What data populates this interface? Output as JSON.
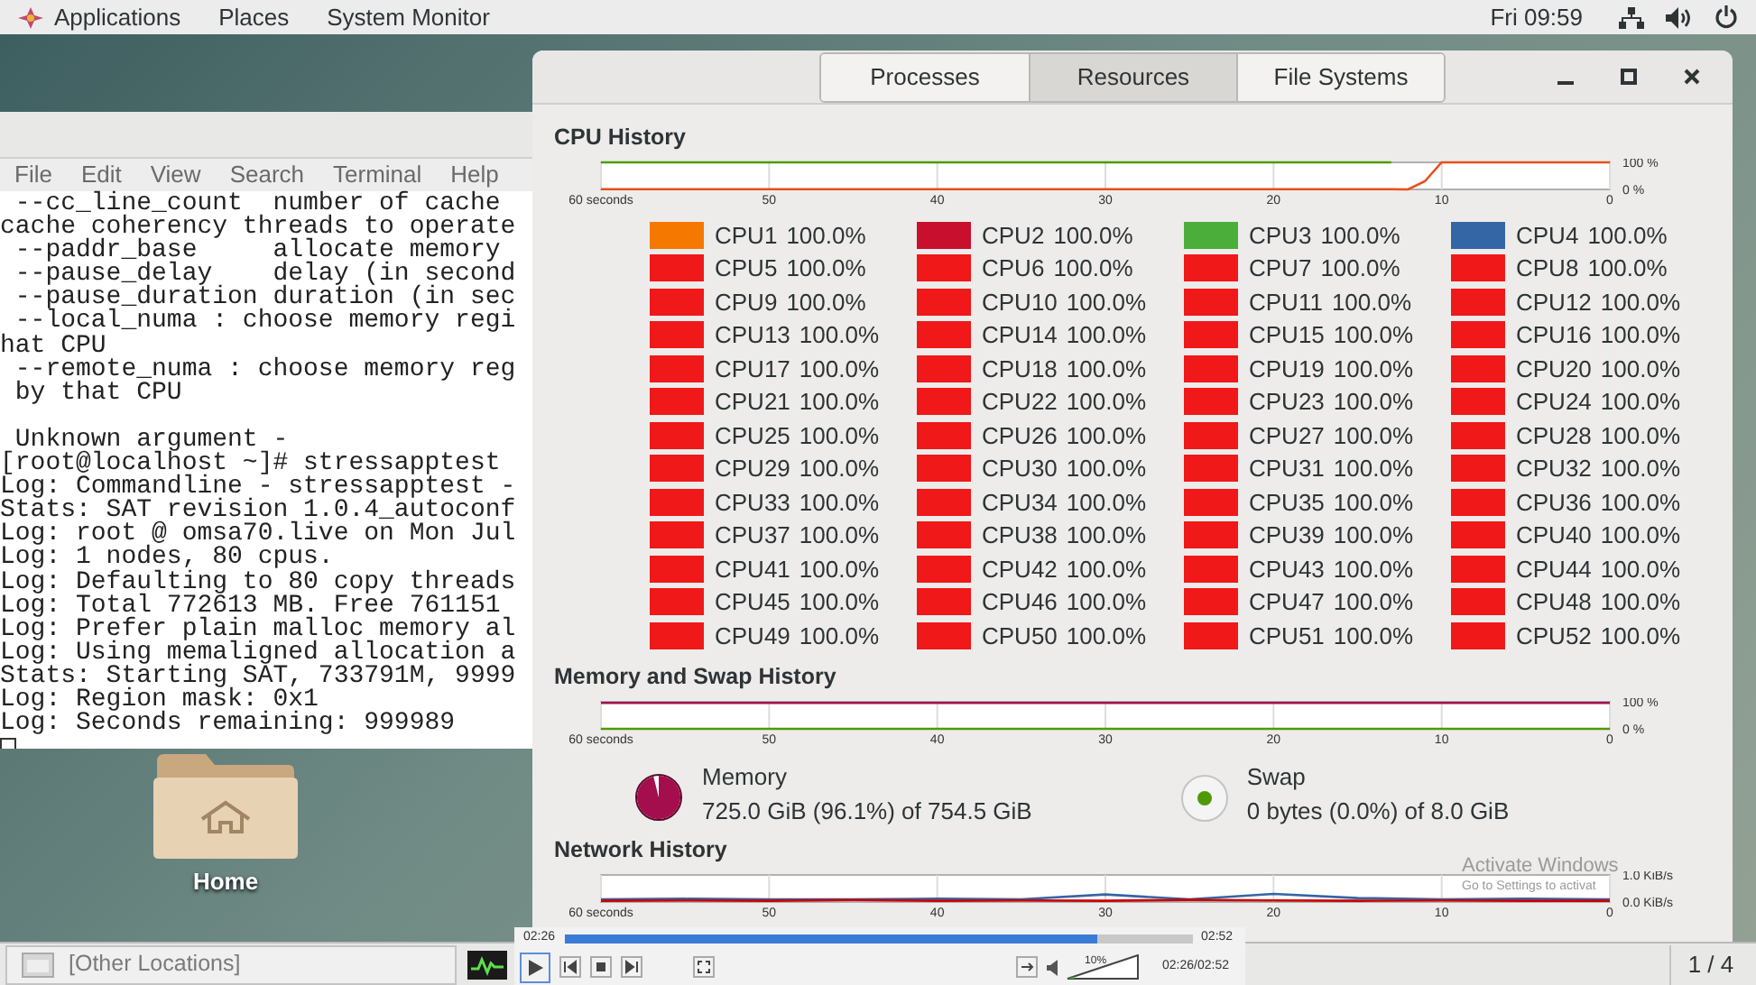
{
  "top_bar": {
    "menus": [
      "Applications",
      "Places",
      "System Monitor"
    ],
    "clock": "Fri 09:59"
  },
  "terminal": {
    "menu": [
      "File",
      "Edit",
      "View",
      "Search",
      "Terminal",
      "Help"
    ],
    "blocks": [
      [
        " --cc_line_count  number of cache",
        "cache coherency threads to operate",
        " --paddr_base     allocate memory",
        " --pause_delay    delay (in second",
        " --pause_duration duration (in sec",
        " --local_numa : choose memory regi",
        "hat CPU",
        " --remote_numa : choose memory reg",
        " by that CPU"
      ],
      [
        " Unknown argument -",
        "[root@localhost ~]# stressapptest",
        "Log: Commandline - stressapptest -",
        "Stats: SAT revision 1.0.4_autoconf",
        "Log: root @ omsa70.live on Mon Jul",
        "Log: 1 nodes, 80 cpus.",
        "Log: Defaulting to 80 copy threads",
        "Log: Total 772613 MB. Free 761151",
        "Log: Prefer plain malloc memory al",
        "Log: Using memaligned allocation a",
        "Stats: Starting SAT, 733791M, 9999",
        "Log: Region mask: 0x1",
        "Log: Seconds remaining: 999989"
      ]
    ]
  },
  "desktop_icons": [
    {
      "label": "Home"
    }
  ],
  "system_monitor": {
    "tabs": [
      {
        "label": "Processes",
        "selected": false
      },
      {
        "label": "Resources",
        "selected": true
      },
      {
        "label": "File Systems",
        "selected": false
      }
    ],
    "cpu_history": {
      "title": "CPU History",
      "chart_data": {
        "type": "line",
        "grid": true,
        "x": [
          60,
          55,
          50,
          45,
          40,
          35,
          30,
          25,
          20,
          15,
          13,
          12,
          11,
          10,
          5,
          0
        ],
        "xlim": [
          60,
          0
        ],
        "ylim": [
          0,
          100
        ],
        "xticks": [
          {
            "value": 60,
            "label": "60 seconds"
          },
          50,
          40,
          30,
          20,
          10,
          0
        ],
        "yticks": [
          {
            "value": 0,
            "label": "0 %"
          },
          {
            "value": 100,
            "label": "100 %"
          }
        ],
        "series": [
          {
            "color": "#4e9a06",
            "values": [
              100,
              100,
              100,
              100,
              100,
              100,
              100,
              100,
              100,
              100,
              100,
              null,
              null,
              null,
              null,
              null
            ]
          },
          {
            "color": "#e8501c",
            "values": [
              1,
              1,
              1,
              1,
              1,
              1,
              1,
              1,
              1,
              1,
              1,
              0,
              30,
              100,
              100,
              100
            ]
          }
        ]
      },
      "legend": [
        {
          "label": "CPU1",
          "reading": "100.0%",
          "color": "#f57900"
        },
        {
          "label": "CPU2",
          "reading": "100.0%",
          "color": "#c8102e"
        },
        {
          "label": "CPU3",
          "reading": "100.0%",
          "color": "#4cae3a"
        },
        {
          "label": "CPU4",
          "reading": "100.0%",
          "color": "#3465a4"
        },
        {
          "label": "CPU5",
          "reading": "100.0%",
          "color": "#f01818"
        },
        {
          "label": "CPU6",
          "reading": "100.0%",
          "color": "#f01818"
        },
        {
          "label": "CPU7",
          "reading": "100.0%",
          "color": "#f01818"
        },
        {
          "label": "CPU8",
          "reading": "100.0%",
          "color": "#f01818"
        },
        {
          "label": "CPU9",
          "reading": "100.0%",
          "color": "#f01818"
        },
        {
          "label": "CPU10",
          "reading": "100.0%",
          "color": "#f01818"
        },
        {
          "label": "CPU11",
          "reading": "100.0%",
          "color": "#f01818"
        },
        {
          "label": "CPU12",
          "reading": "100.0%",
          "color": "#f01818"
        },
        {
          "label": "CPU13",
          "reading": "100.0%",
          "color": "#f01818"
        },
        {
          "label": "CPU14",
          "reading": "100.0%",
          "color": "#f01818"
        },
        {
          "label": "CPU15",
          "reading": "100.0%",
          "color": "#f01818"
        },
        {
          "label": "CPU16",
          "reading": "100.0%",
          "color": "#f01818"
        },
        {
          "label": "CPU17",
          "reading": "100.0%",
          "color": "#f01818"
        },
        {
          "label": "CPU18",
          "reading": "100.0%",
          "color": "#f01818"
        },
        {
          "label": "CPU19",
          "reading": "100.0%",
          "color": "#f01818"
        },
        {
          "label": "CPU20",
          "reading": "100.0%",
          "color": "#f01818"
        },
        {
          "label": "CPU21",
          "reading": "100.0%",
          "color": "#f01818"
        },
        {
          "label": "CPU22",
          "reading": "100.0%",
          "color": "#f01818"
        },
        {
          "label": "CPU23",
          "reading": "100.0%",
          "color": "#f01818"
        },
        {
          "label": "CPU24",
          "reading": "100.0%",
          "color": "#f01818"
        },
        {
          "label": "CPU25",
          "reading": "100.0%",
          "color": "#f01818"
        },
        {
          "label": "CPU26",
          "reading": "100.0%",
          "color": "#f01818"
        },
        {
          "label": "CPU27",
          "reading": "100.0%",
          "color": "#f01818"
        },
        {
          "label": "CPU28",
          "reading": "100.0%",
          "color": "#f01818"
        },
        {
          "label": "CPU29",
          "reading": "100.0%",
          "color": "#f01818"
        },
        {
          "label": "CPU30",
          "reading": "100.0%",
          "color": "#f01818"
        },
        {
          "label": "CPU31",
          "reading": "100.0%",
          "color": "#f01818"
        },
        {
          "label": "CPU32",
          "reading": "100.0%",
          "color": "#f01818"
        },
        {
          "label": "CPU33",
          "reading": "100.0%",
          "color": "#f01818"
        },
        {
          "label": "CPU34",
          "reading": "100.0%",
          "color": "#f01818"
        },
        {
          "label": "CPU35",
          "reading": "100.0%",
          "color": "#f01818"
        },
        {
          "label": "CPU36",
          "reading": "100.0%",
          "color": "#f01818"
        },
        {
          "label": "CPU37",
          "reading": "100.0%",
          "color": "#f01818"
        },
        {
          "label": "CPU38",
          "reading": "100.0%",
          "color": "#f01818"
        },
        {
          "label": "CPU39",
          "reading": "100.0%",
          "color": "#f01818"
        },
        {
          "label": "CPU40",
          "reading": "100.0%",
          "color": "#f01818"
        },
        {
          "label": "CPU41",
          "reading": "100.0%",
          "color": "#f01818"
        },
        {
          "label": "CPU42",
          "reading": "100.0%",
          "color": "#f01818"
        },
        {
          "label": "CPU43",
          "reading": "100.0%",
          "color": "#f01818"
        },
        {
          "label": "CPU44",
          "reading": "100.0%",
          "color": "#f01818"
        },
        {
          "label": "CPU45",
          "reading": "100.0%",
          "color": "#f01818"
        },
        {
          "label": "CPU46",
          "reading": "100.0%",
          "color": "#f01818"
        },
        {
          "label": "CPU47",
          "reading": "100.0%",
          "color": "#f01818"
        },
        {
          "label": "CPU48",
          "reading": "100.0%",
          "color": "#f01818"
        },
        {
          "label": "CPU49",
          "reading": "100.0%",
          "color": "#f01818"
        },
        {
          "label": "CPU50",
          "reading": "100.0%",
          "color": "#f01818"
        },
        {
          "label": "CPU51",
          "reading": "100.0%",
          "color": "#f01818"
        },
        {
          "label": "CPU52",
          "reading": "100.0%",
          "color": "#f01818"
        }
      ]
    },
    "memory_history": {
      "title": "Memory and Swap History",
      "chart_data": {
        "type": "line",
        "grid": true,
        "x": [
          60,
          0
        ],
        "xlim": [
          60,
          0
        ],
        "ylim": [
          0,
          100
        ],
        "xticks": [
          {
            "value": 60,
            "label": "60 seconds"
          },
          50,
          40,
          30,
          20,
          10,
          0
        ],
        "yticks": [
          {
            "value": 0,
            "label": "0 %"
          },
          {
            "value": 100,
            "label": "100 %"
          }
        ],
        "series": [
          {
            "color": "#a40e4c",
            "values": [
              96,
              96
            ]
          },
          {
            "color": "#4e9a06",
            "values": [
              0,
              0
            ]
          }
        ]
      },
      "items": [
        {
          "kind": "pie",
          "name": "Memory",
          "detail": "725.0 GiB (96.1%) of 754.5 GiB",
          "color": "#a40e4c",
          "level": 0.961
        },
        {
          "kind": "ring",
          "name": "Swap",
          "detail": "0 bytes (0.0%) of 8.0 GiB",
          "color": "#4e9a06"
        }
      ]
    },
    "network_history": {
      "title": "Network History",
      "chart_data": {
        "type": "line",
        "grid": true,
        "x": [
          60,
          55,
          50,
          45,
          40,
          35,
          30,
          25,
          20,
          15,
          10,
          5,
          0
        ],
        "xlim": [
          60,
          0
        ],
        "ylim": [
          0,
          1
        ],
        "xticks": [
          {
            "value": 60,
            "label": "60 seconds"
          },
          50,
          40,
          30,
          20,
          10,
          0
        ],
        "yticks": [
          {
            "value": 0,
            "label": "0.0 KiB/s"
          },
          {
            "value": 1,
            "label": "1.0 KiB/s"
          }
        ],
        "series": [
          {
            "color": "#3465a4",
            "values": [
              0.1,
              0.12,
              0.1,
              0.1,
              0.12,
              0.1,
              0.28,
              0.1,
              0.3,
              0.15,
              0.1,
              0.12,
              0.1
            ]
          },
          {
            "color": "#cc0000",
            "values": [
              0.05,
              0.06,
              0.05,
              0.07,
              0.05,
              0.06,
              0.05,
              0.08,
              0.06,
              0.05,
              0.06,
              0.05,
              0.05
            ]
          }
        ]
      }
    }
  },
  "activation_notice": {
    "title": "Activate Windows",
    "text": "Go to Settings to activat"
  },
  "taskbar": {
    "items": [
      {
        "label": "[Other Locations]"
      }
    ],
    "workspace": "1 / 4"
  },
  "media_player": {
    "elapsed": "02:26",
    "duration": "02:52",
    "progress": {
      "level": 0.85
    },
    "volume": {
      "level": 0.1,
      "reading": "10%"
    },
    "position": "02:26/02:52"
  }
}
